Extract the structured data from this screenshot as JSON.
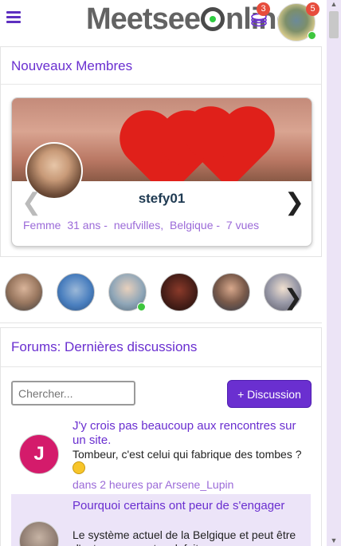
{
  "header": {
    "logo_left": "Meetsee",
    "logo_right": "nline",
    "coins_badge": "3",
    "avatar_badge": "5"
  },
  "new_members": {
    "title": "Nouveaux Membres",
    "member": {
      "name": "stefy01",
      "gender": "Femme",
      "age": "31 ans -",
      "city": "neufvilles,",
      "country": "Belgique -",
      "views": "7 vues"
    }
  },
  "forums": {
    "title": "Forums: Dernières discussions",
    "search_placeholder": "Chercher...",
    "discussion_button": "+ Discussion",
    "threads": [
      {
        "avatar_letter": "J",
        "title": "J'y crois pas beaucoup aux rencontres sur un site.",
        "excerpt": "Tombeur, c'est celui qui fabrique des tombes ?",
        "meta": "dans 2 heures par Arsene_Lupin"
      },
      {
        "avatar_letter": "",
        "title": "Pourquoi certains ont peur de s'engager",
        "excerpt": "Le système actuel de la Belgique et peut être d'autres pays est mal, fait"
      }
    ]
  },
  "icons": {
    "menu": "hamburger-menu-icon",
    "coins": "coins-icon",
    "prev": "chevron-left-icon",
    "next": "chevron-right-icon"
  },
  "colors": {
    "accent": "#6a2fd0",
    "link": "#9b6ad8",
    "badge": "#e74c3c",
    "online": "#3ec63e",
    "thread_highlight": "#ece4f8"
  }
}
